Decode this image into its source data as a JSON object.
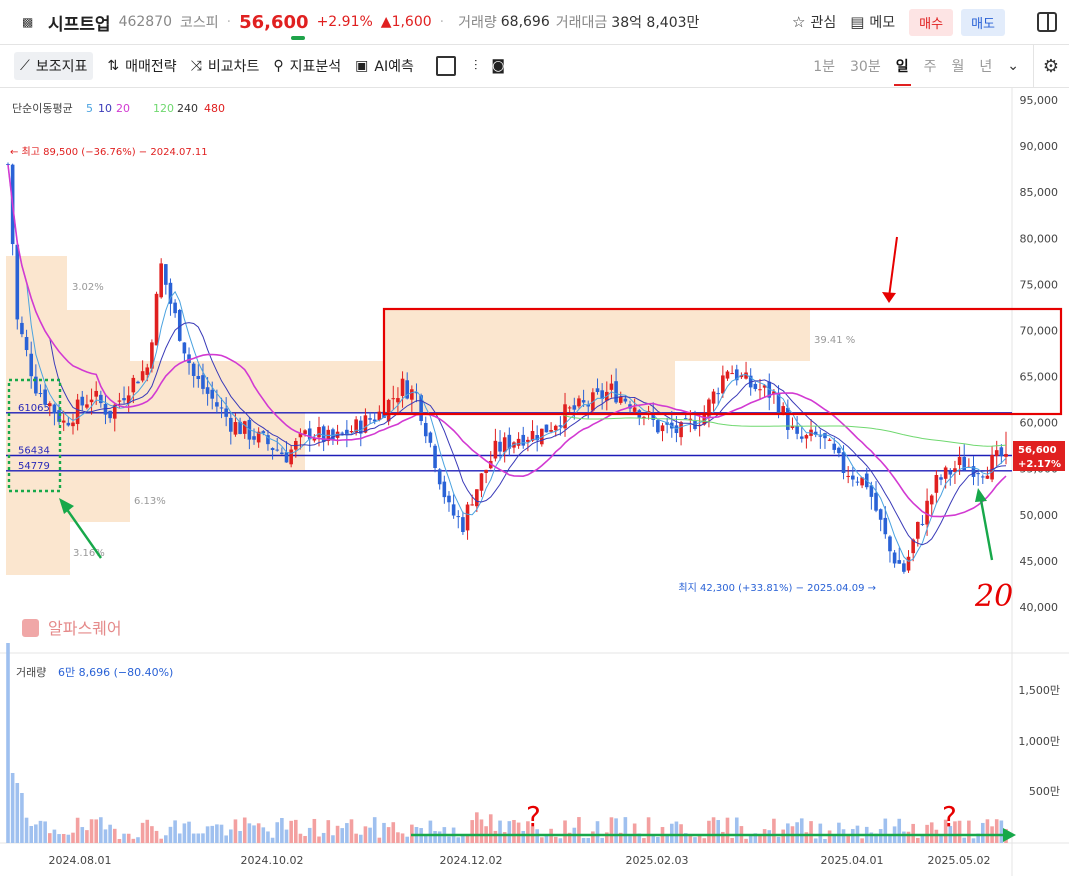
{
  "header": {
    "stock_name": "시프트업",
    "stock_code": "462870",
    "market": "코스피",
    "price": "56,600",
    "change_pct": "+2.91%",
    "change_abs": "▲1,600",
    "volume_label": "거래량",
    "volume_value": "68,696",
    "amount_label": "거래대금",
    "amount_value": "38억 8,403만",
    "watch_label": "관심",
    "memo_label": "메모",
    "buy_label": "매수",
    "sell_label": "매도"
  },
  "toolbar": {
    "indicators": "보조지표",
    "strategy": "매매전략",
    "compare": "비교차트",
    "analysis": "지표분석",
    "ai_predict": "AI예측",
    "periods": [
      "1분",
      "30분",
      "일",
      "주",
      "월",
      "년"
    ],
    "selected_period": "일"
  },
  "colors": {
    "up": "#e02020",
    "down": "#2a62d6",
    "highlight_zone": "#fbe6cf",
    "ma5": "#4ba3e0",
    "ma10": "#3a3ab8",
    "ma20": "#d23ad2",
    "ma120": "#6fd86f",
    "annotation_red": "#e60000",
    "annotation_green": "#17a84a"
  },
  "chart_data": {
    "type": "candlestick",
    "ma_legend": {
      "label": "단순이동평균",
      "periods": [
        "5",
        "10",
        "20",
        "120",
        "240",
        "480"
      ]
    },
    "y_ticks": [
      "95,000",
      "90,000",
      "85,000",
      "80,000",
      "75,000",
      "70,000",
      "65,000",
      "60,000",
      "55,000",
      "50,000",
      "45,000",
      "40,000"
    ],
    "ylim": [
      38500,
      96500
    ],
    "x_ticks": [
      "2024.08.01",
      "2024.10.02",
      "2024.12.02",
      "2025.02.03",
      "2025.04.01",
      "2025.05.02"
    ],
    "high_annotation": "최고 89,500 (−36.76%) − 2024.07.11",
    "low_annotation": "최지 42,300 (+33.81%) − 2025.04.09",
    "last_price_label": "56,600",
    "last_change_label": "+2.17%",
    "horizontal_lines": [
      61065,
      56434,
      54779
    ],
    "horizontal_line_labels": [
      "61065",
      "56434",
      "54779"
    ],
    "volume_profile_labels": [
      "3.02%",
      "39.41 %",
      "6.13%",
      "3.16%"
    ],
    "watermark": "알파스퀘어",
    "volume_panel": {
      "label": "거래량",
      "value_text": "6만 8,696 (−80.40%)",
      "y_ticks": [
        "1,500만",
        "1,000만",
        "500만"
      ]
    },
    "annotations_text": [
      "20",
      "?",
      "?"
    ],
    "series": [
      {
        "name": "5",
        "type": "ma"
      },
      {
        "name": "10",
        "type": "ma"
      },
      {
        "name": "20",
        "type": "ma"
      },
      {
        "name": "120",
        "type": "ma"
      }
    ]
  }
}
